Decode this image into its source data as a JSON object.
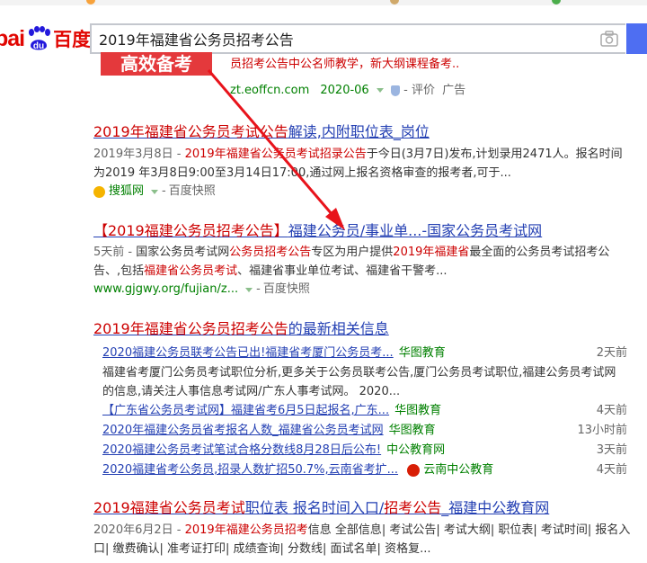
{
  "search": {
    "query": "2019年福建省公务员招考公告",
    "logo_en": "bai",
    "logo_du": "du",
    "logo_cn": "百度"
  },
  "ad": {
    "banner_text": "高效备考",
    "snippet": "员招考公告中公名师教学，新大纲课程备考..",
    "url": "zt.eoffcn.com",
    "date": "2020-06",
    "rate_label": "评价",
    "ad_label": "广告"
  },
  "results": [
    {
      "title_pre": "2019年福建省公务员考试公告",
      "title_post": "解读,内附职位表_岗位",
      "date": "2019年3月8日",
      "abstract_red": "2019年福建省公务员考试招录公告",
      "abstract": "于今日(3月7日)发布,计划录用2471人。报名时间为2019 年3月8日9:00至3月14日17:00,通过网上报名资格审查的报考者,可于...",
      "source": "搜狐网",
      "cache": "百度快照"
    },
    {
      "title_pre": "【2019福建公务员招考公告】",
      "title_post": "福建公务员/事业单...-国家公务员考试网",
      "date": "5天前",
      "abstract_a": "国家公务员考试网",
      "abstract_b": "公务员招考公告",
      "abstract_c": "专区为用户提供",
      "abstract_d": "2019年福建省",
      "abstract_e": "最全面的公务员考试招考公告、,包括",
      "abstract_f": "福建省公务员考试",
      "abstract_g": "、福建省事业单位考试、福建省干警考...",
      "url": "www.gjgwy.org/fujian/z...",
      "cache": "百度快照"
    }
  ],
  "news": {
    "title_pre": "2019年福建省公务员招考公告",
    "title_post": "的最新相关信息",
    "items": [
      {
        "text": "2020福建公务员联考公告已出!福建省考厦门公务员考...",
        "source": "华图教育",
        "time": "2天前"
      },
      {
        "text": "【广东省公务员考试网】福建省考6月5日起报名,广东...",
        "source": "华图教育",
        "time": "4天前"
      },
      {
        "text": "2020年福建公务员省考报名人数_福建省公务员考试网",
        "source": "华图教育",
        "time": "13小时前"
      },
      {
        "text": "2020福建公务员考试笔试合格分数线8月28日后公布!",
        "source": "中公教育网",
        "time": "3天前"
      },
      {
        "text": "2020福建省考公务员,招录人数扩招50.7%,云南省考扩...",
        "source": "云南中公教育",
        "time": "4天前"
      }
    ],
    "abstract": "福建省考厦门公务员考试职位分析,更多关于公务员联考公告,厦门公务员考试职位,福建公务员考试网的信息,请关注人事信息考试网/广东人事考试网。 2020..."
  },
  "last": {
    "title_pre": "2019福建省公务员考试",
    "title_mid": "职位表 报名时间入口/",
    "title_red2": "招考公告",
    "title_post": "_福建中公教育网",
    "date": "2020年6月2日",
    "abstract_red": "2019年福建公务员招考",
    "abstract": "信息 全部信息| 考试公告| 考试大纲| 职位表| 考试时间| 报名入口| 缴费确认| 准考证打印| 成绩查询| 分数线| 面试名单| 资格复..."
  },
  "colors": {
    "link": "#2440b3",
    "red": "#cc0000",
    "green": "#008000",
    "arrow": "#e8131b",
    "button": "#4e6ef2"
  }
}
